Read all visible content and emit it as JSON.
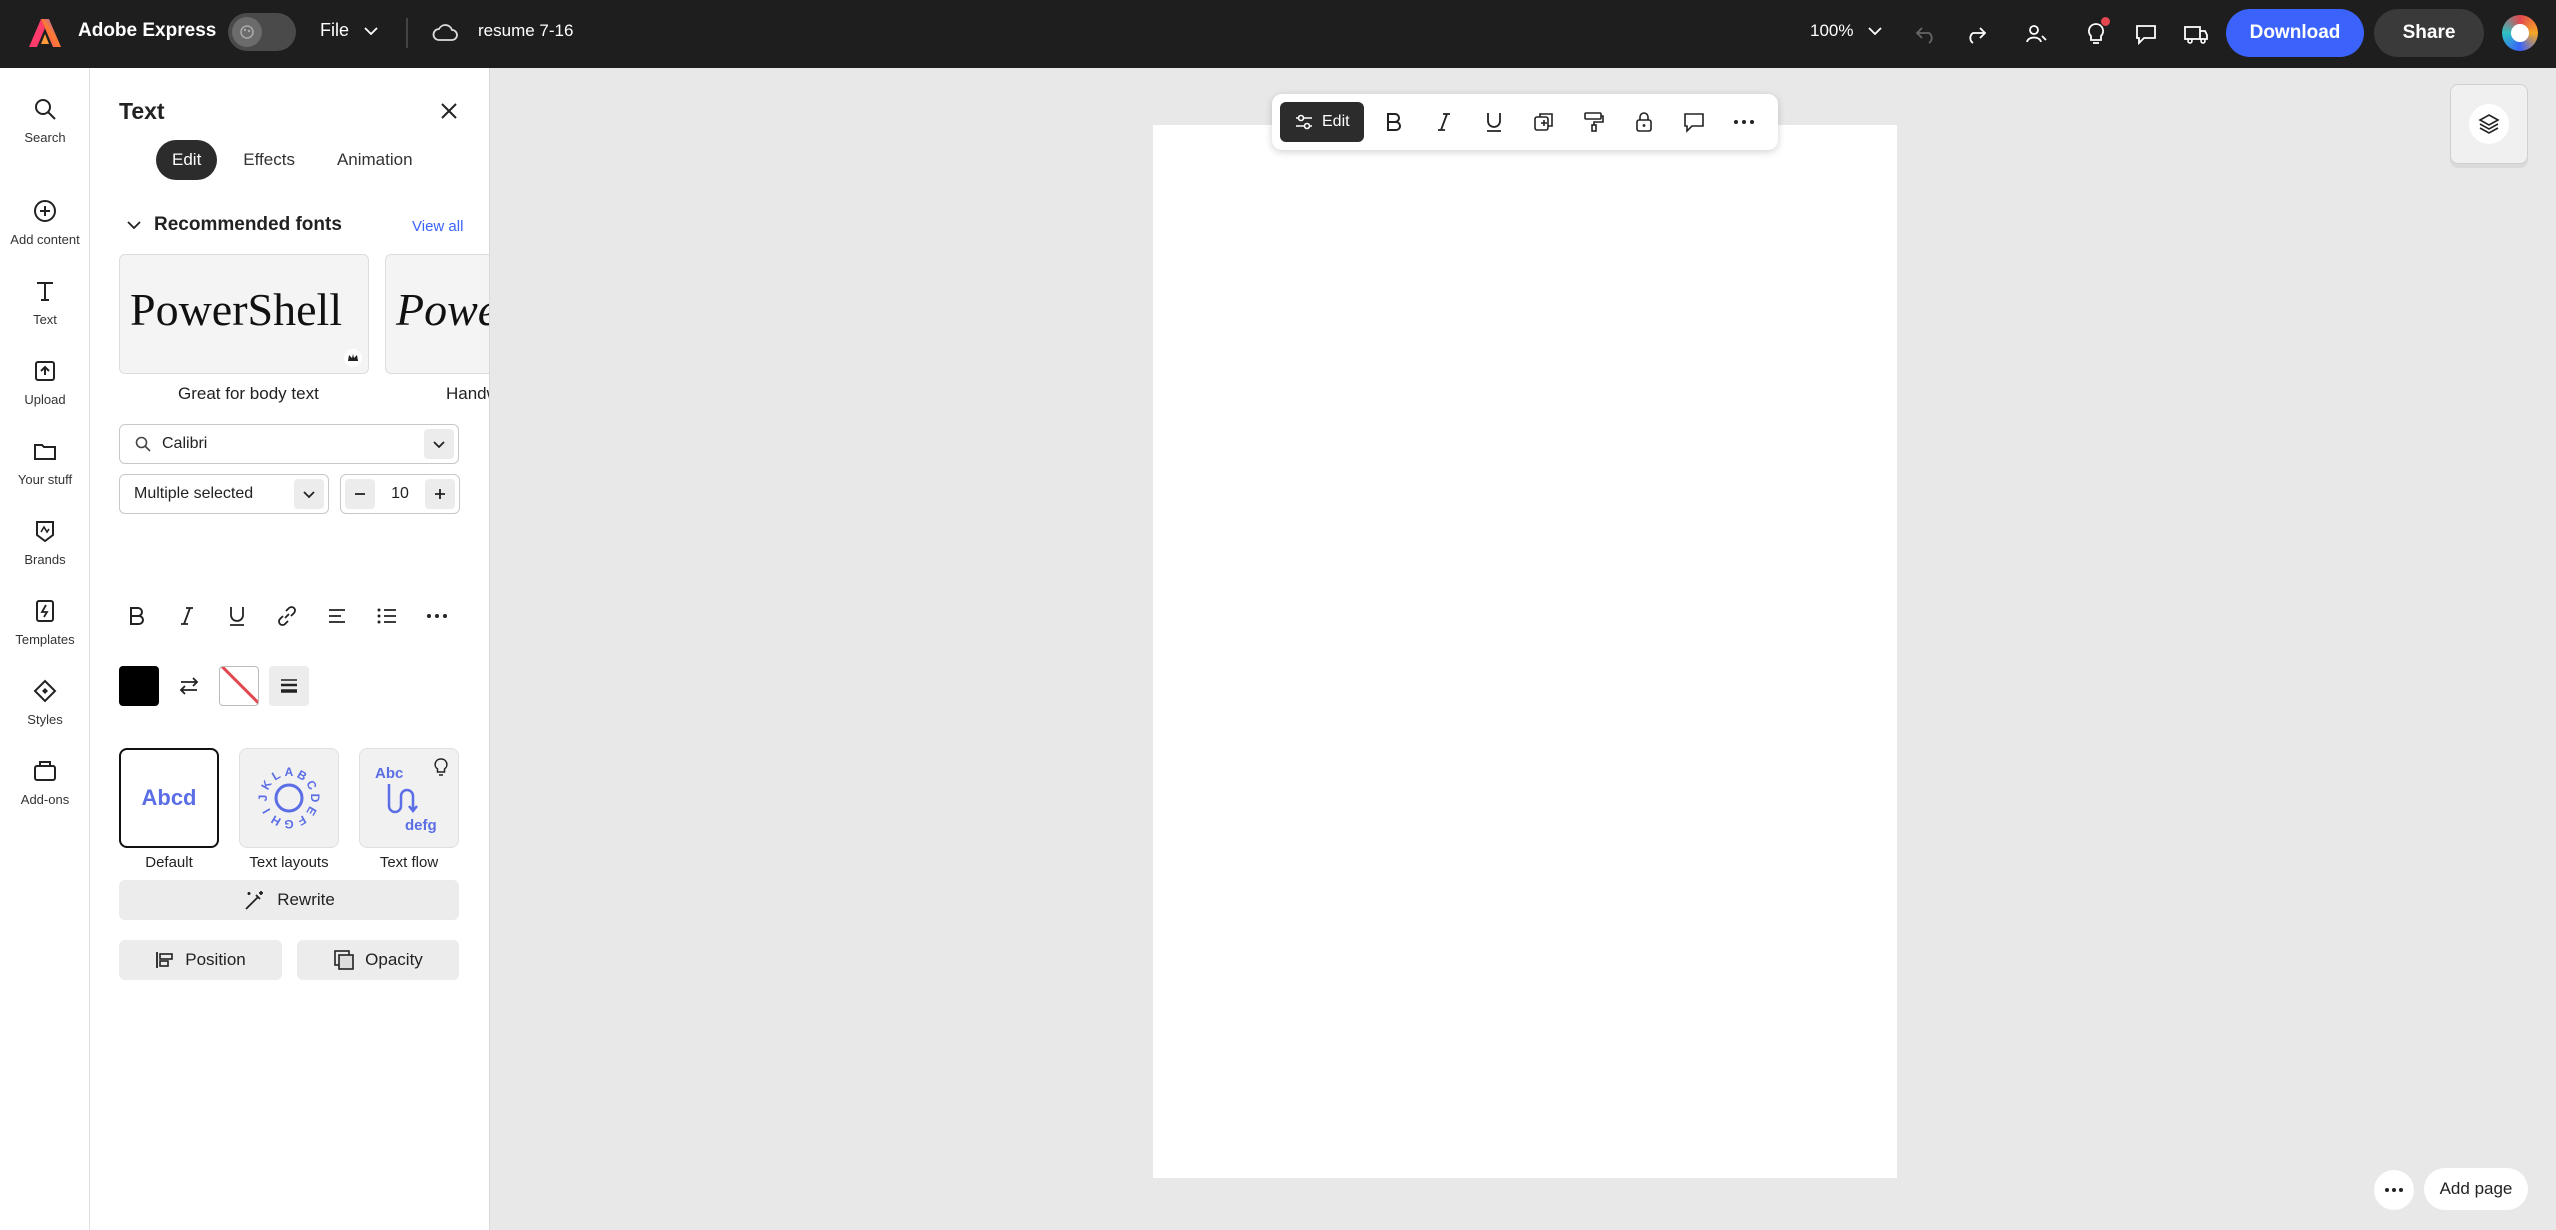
{
  "header": {
    "app_name": "Adobe Express",
    "file_menu": "File",
    "doc_name": "resume 7-16",
    "zoom": "100%",
    "download_label": "Download",
    "share_label": "Share"
  },
  "rail": {
    "items": [
      {
        "label": "Search",
        "icon": "search-icon"
      },
      {
        "label": "Add content",
        "icon": "plus-circle-icon"
      },
      {
        "label": "Text",
        "icon": "text-icon"
      },
      {
        "label": "Upload",
        "icon": "upload-icon"
      },
      {
        "label": "Your stuff",
        "icon": "folder-icon"
      },
      {
        "label": "Brands",
        "icon": "brand-icon"
      },
      {
        "label": "Templates",
        "icon": "templates-icon"
      },
      {
        "label": "Styles",
        "icon": "styles-icon"
      },
      {
        "label": "Add-ons",
        "icon": "addons-icon"
      }
    ]
  },
  "panel": {
    "title": "Text",
    "tabs": [
      {
        "label": "Edit",
        "active": true
      },
      {
        "label": "Effects",
        "active": false
      },
      {
        "label": "Animation",
        "active": false
      }
    ],
    "recommended_heading": "Recommended fonts",
    "view_all": "View all",
    "font_cards": [
      {
        "sample": "PowerShell",
        "caption": "Great for body text"
      },
      {
        "sample": "PowerShell",
        "caption": "Handwritten"
      }
    ],
    "font_search_value": "Calibri",
    "style_select": "Multiple selected",
    "font_size": "10",
    "text_color": "#000000",
    "layouts": [
      {
        "preview": "Abcd",
        "caption": "Default"
      },
      {
        "preview": "ABCDEFGHIJKL",
        "caption": "Text layouts"
      },
      {
        "preview_top": "Abc",
        "preview_bottom": "defg",
        "caption": "Text flow"
      }
    ],
    "rewrite_label": "Rewrite",
    "position_label": "Position",
    "opacity_label": "Opacity"
  },
  "canvas_toolbar": {
    "edit_label": "Edit"
  },
  "footer": {
    "add_page_label": "Add page"
  },
  "colors": {
    "accent": "#3b63fb",
    "topbar": "#1e1e1e",
    "canvas_bg": "#e8e8e8",
    "notification": "#e34850"
  }
}
